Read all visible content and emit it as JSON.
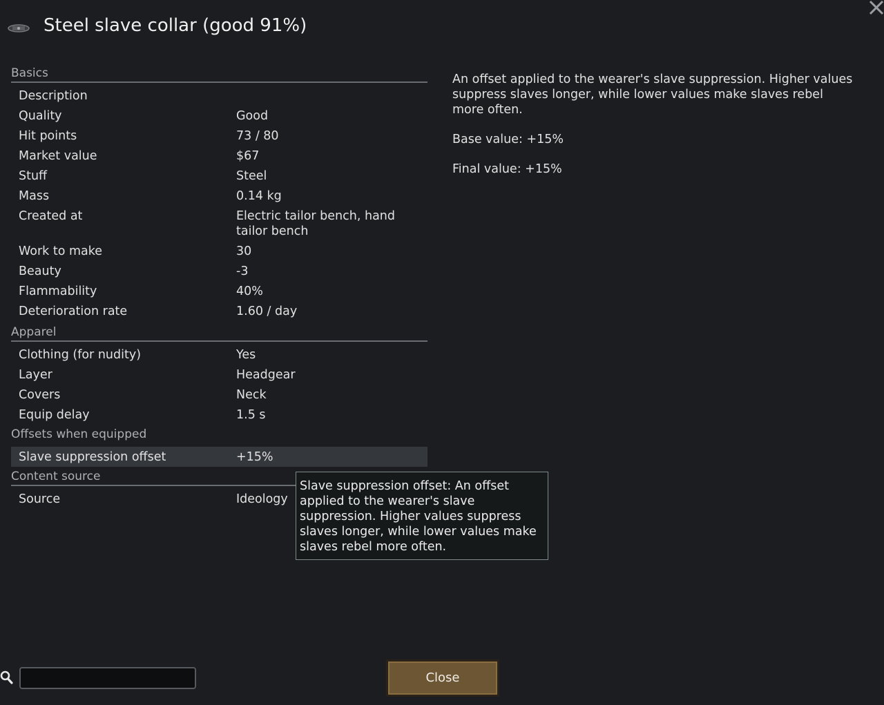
{
  "title": "Steel slave collar (good 91%)",
  "icons": {
    "item": "collar-icon",
    "window_close": "close-x-icon",
    "search": "search-icon"
  },
  "sections": {
    "basics": {
      "header": "Basics",
      "rows": [
        {
          "label": "Description",
          "value": ""
        },
        {
          "label": "Quality",
          "value": "Good"
        },
        {
          "label": "Hit points",
          "value": "73 / 80"
        },
        {
          "label": "Market value",
          "value": "$67"
        },
        {
          "label": "Stuff",
          "value": "Steel"
        },
        {
          "label": "Mass",
          "value": "0.14 kg"
        },
        {
          "label": "Created at",
          "value": "Electric tailor bench, hand tailor bench"
        },
        {
          "label": "Work to make",
          "value": "30"
        },
        {
          "label": "Beauty",
          "value": "-3"
        },
        {
          "label": "Flammability",
          "value": "40%"
        },
        {
          "label": "Deterioration rate",
          "value": "1.60 / day"
        }
      ]
    },
    "apparel": {
      "header": "Apparel",
      "rows": [
        {
          "label": "Clothing (for nudity)",
          "value": "Yes"
        },
        {
          "label": "Layer",
          "value": "Headgear"
        },
        {
          "label": "Covers",
          "value": "Neck"
        },
        {
          "label": "Equip delay",
          "value": "1.5 s"
        }
      ]
    },
    "offsets": {
      "header": "Offsets when equipped",
      "rows": [
        {
          "label": "Slave suppression offset",
          "value": "+15%"
        }
      ]
    },
    "content_source": {
      "header": "Content source",
      "rows": [
        {
          "label": "Source",
          "value": "Ideology"
        }
      ]
    }
  },
  "description": {
    "text": "An offset applied to the wearer's slave suppression. Higher values suppress slaves longer, while lower values make slaves rebel more often.",
    "base_value": "Base value: +15%",
    "final_value": "Final value: +15%"
  },
  "tooltip": {
    "text": "Slave suppression offset: An offset applied to the wearer's slave suppression. Higher values suppress slaves longer, while lower values make slaves rebel more often."
  },
  "search": {
    "value": "",
    "placeholder": ""
  },
  "close_button": {
    "label": "Close"
  },
  "colors": {
    "background": "#1b1d21",
    "button": "#6c5634",
    "selected_row": "#34373c"
  }
}
